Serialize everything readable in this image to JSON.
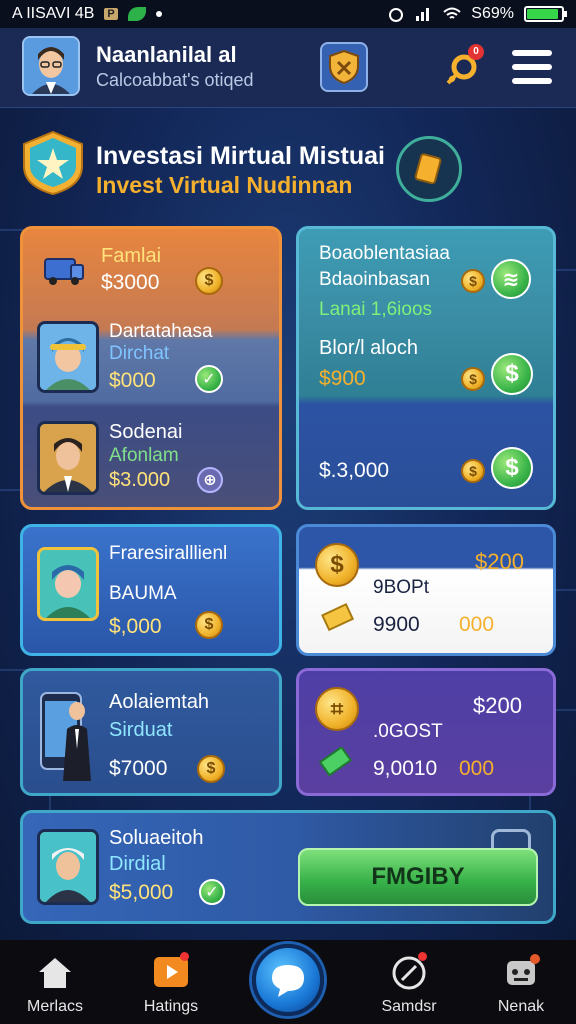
{
  "status_bar": {
    "carrier": "A IISAVI 4B",
    "badge": "P",
    "battery": "S69%",
    "battery_level": 0.9
  },
  "header": {
    "name": "Naanlanilal al",
    "subtitle": "Calcoabbat's otiqed",
    "notification_count": "0"
  },
  "title": {
    "main": "Investasi Mirtual Mistuai",
    "sub": "Invest Virtual Nudinnan"
  },
  "portfolio_card": {
    "items": [
      {
        "label": "Famlai",
        "value": "$3000"
      },
      {
        "label": "Dartatahasa",
        "sublabel": "Dirchat",
        "value": "$000"
      },
      {
        "label": "Sodenai",
        "sublabel": "Afonlam",
        "value": "$3.000"
      }
    ]
  },
  "summary_card": {
    "line1": "Boaoblentasiaa",
    "line2": "Bdaoinbasan",
    "line3": "Lanai 1,6ioos",
    "line4": "Blor/l aloch",
    "line4_value": "$900",
    "total": "$.3,000"
  },
  "card_frase": {
    "label": "Fraresiralllienl",
    "sublabel": "BAUMA",
    "value": "$,000"
  },
  "card_price1": {
    "price": "$200",
    "line1": "9BOPt",
    "line2": "9900",
    "line2_right": "000"
  },
  "card_aola": {
    "label": "Aolaiemtah",
    "sublabel": "Sirduat",
    "value": "$7000"
  },
  "card_price2": {
    "price": "$200",
    "line1": ".0GOST",
    "line2": "9,0010",
    "line2_right": "000"
  },
  "card_solu": {
    "label": "Soluaeitoh",
    "sublabel": "Dirdial",
    "value": "$5,000",
    "button": "FMGIBY"
  },
  "bottom_nav": [
    {
      "label": "Merlacs",
      "icon": "home-icon"
    },
    {
      "label": "Hatings",
      "icon": "play-icon"
    },
    {
      "label": "",
      "icon": "chat-icon"
    },
    {
      "label": "Samdsr",
      "icon": "compass-icon"
    },
    {
      "label": "Nenak",
      "icon": "robot-icon"
    }
  ],
  "colors": {
    "accent_orange": "#f5b02d",
    "accent_green": "#3bb54a",
    "bg_navy": "#13285a"
  }
}
